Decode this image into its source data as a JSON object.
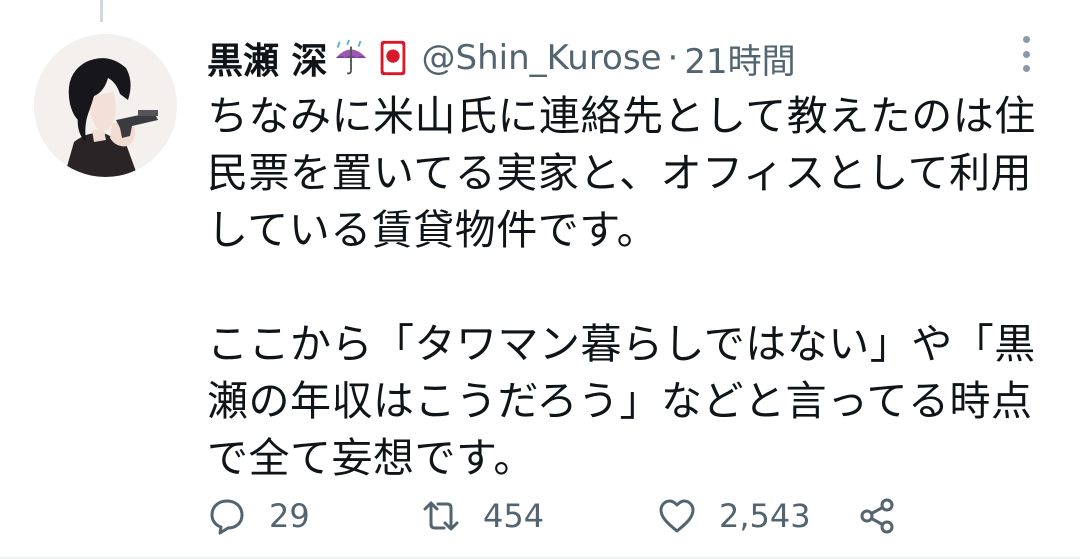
{
  "author": {
    "display_name": "黒瀬 深",
    "handle": "@Shin_Kurose",
    "separator": "·",
    "timestamp": "21時間",
    "emoji_icons": [
      "umbrella-rain-icon",
      "japan-flag-card-icon"
    ]
  },
  "tweet": {
    "lines": [
      "ちなみに米山氏に連絡先として教えたのは住",
      "民票を置いてる実家と、オフィスとして利用",
      "している賃貸物件です。",
      "",
      "ここから「タワマン暮らしではない」や「黒",
      "瀬の年収はこうだろう」などと言ってる時点",
      "で全て妄想です。"
    ]
  },
  "actions": {
    "reply_count": "29",
    "retweet_count": "454",
    "like_count": "2,543"
  },
  "colors": {
    "text": "#0f1419",
    "secondary": "#536471",
    "thread_line": "#cfd9de",
    "umbrella": "#9b59b6",
    "flag_red": "#d7192c"
  }
}
